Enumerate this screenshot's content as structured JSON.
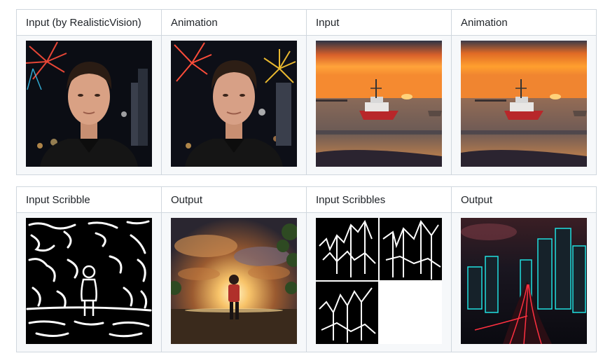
{
  "table1": {
    "headers": [
      "Input (by RealisticVision)",
      "Animation",
      "Input",
      "Animation"
    ],
    "images": [
      "portrait-fireworks-image",
      "portrait-animation-image",
      "sunset-boat-image",
      "sunset-boat-animation-image"
    ]
  },
  "table2": {
    "headers": [
      "Input Scribble",
      "Output",
      "Input Scribbles",
      "Output"
    ],
    "images": [
      "scribble-child-image",
      "child-sunset-output-image",
      "scribbles-city-image",
      "neon-city-output-image"
    ]
  }
}
